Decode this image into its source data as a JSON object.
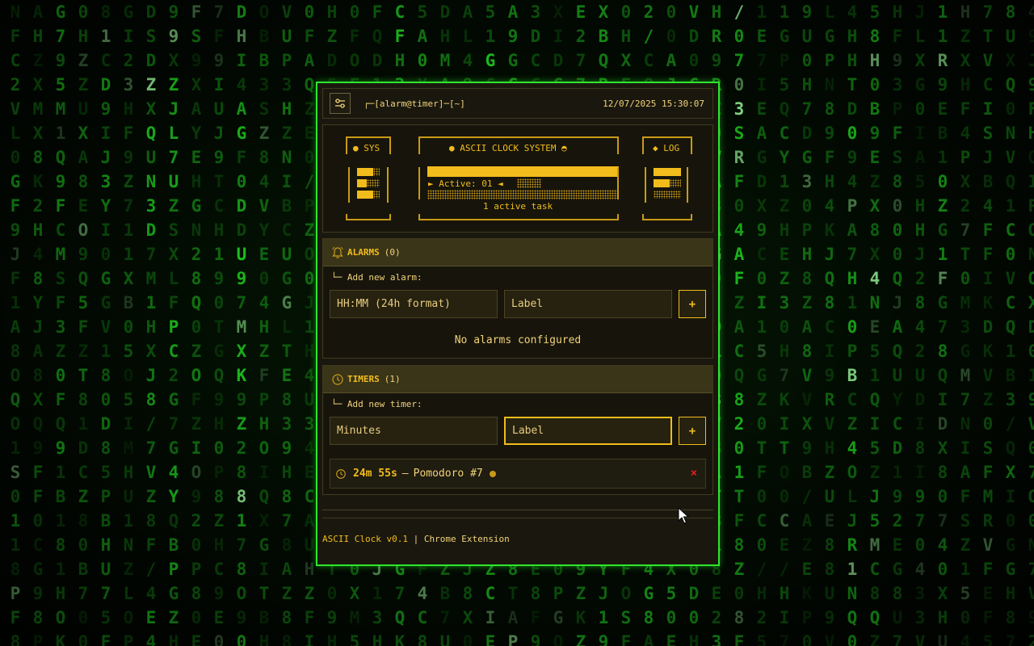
{
  "background": {
    "glyphs": "XIK4CJ/V18BUOY0XZGHU7H0BE0J23Z01DAHTZ5Q9P1F7OI0GCTF8QNAX79F08A4LSH2E9R89PH58Z0QD7V5CD1F8FGZ3Z4M"
  },
  "topbar": {
    "prompt": "┌─[alarm@timer]─[~]",
    "datetime": "12/07/2025 15:30:07"
  },
  "ascii": {
    "sys_label": "● SYS",
    "system_title": "● ASCII CLOCK SYSTEM ◓",
    "active_text": "► Active: 01 ◄",
    "active_tasks": "1 active task",
    "log_label": "◆ LOG"
  },
  "alarms": {
    "title": "ALARMS",
    "count": "(0)",
    "add_label": "└─ Add new alarm:",
    "time_placeholder": "HH:MM (24h format)",
    "label_placeholder": "Label",
    "add_button": "+",
    "empty_message": "No alarms configured"
  },
  "timers": {
    "title": "TIMERS",
    "count": "(1)",
    "add_label": "└─ Add new timer:",
    "minutes_placeholder": "Minutes",
    "label_placeholder": "Label",
    "add_button": "+",
    "items": [
      {
        "time": "24m 55s",
        "separator": "—",
        "label": "Pomodoro #7",
        "delete": "×"
      }
    ]
  },
  "footer": {
    "brand": "ASCII Clock v0.1",
    "separator": " | ",
    "platform": "Chrome Extension"
  },
  "colors": {
    "accent": "#f2bc1c",
    "matrix_green": "#1fd11f",
    "popup_border": "#2ee62e",
    "danger": "#e02020"
  }
}
